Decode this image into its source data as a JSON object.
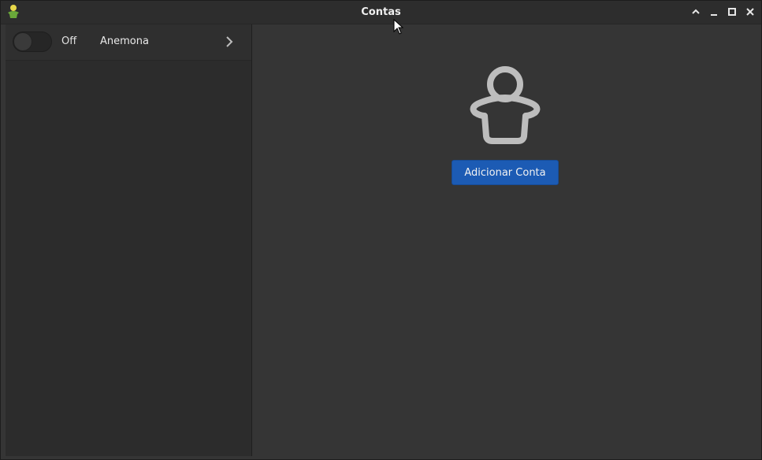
{
  "window": {
    "title": "Contas",
    "app_icon": "user-accounts-icon"
  },
  "titlebar_buttons": [
    "shade-icon",
    "minimize-icon",
    "maximize-icon",
    "close-icon"
  ],
  "sidebar": {
    "accounts": [
      {
        "toggle_state": "Off",
        "name": "Anemona"
      }
    ]
  },
  "main": {
    "placeholder_icon": "user-avatar-icon",
    "add_button_label": "Adicionar Conta"
  },
  "colors": {
    "accent": "#1c5bb4",
    "background": "#353535",
    "sidebar": "#2c2c2c"
  }
}
